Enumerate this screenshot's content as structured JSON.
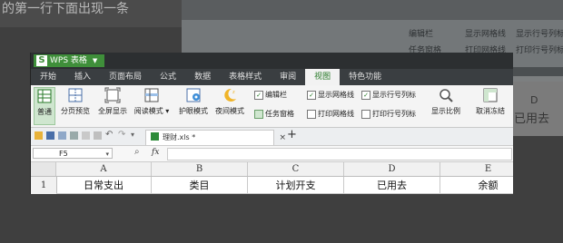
{
  "background": {
    "top_text": "的第一行下面出现一条",
    "right_text_1": "D",
    "right_text_2": "已用去",
    "bg_toolbar": [
      "编辑栏",
      "显示网格线",
      "显示行号列标",
      "任务窗格",
      "打印网格线",
      "打印行号列标"
    ]
  },
  "app": {
    "title": "WPS 表格"
  },
  "menu": [
    {
      "label": "开始",
      "active": false
    },
    {
      "label": "插入",
      "active": false
    },
    {
      "label": "页面布局",
      "active": false
    },
    {
      "label": "公式",
      "active": false
    },
    {
      "label": "数据",
      "active": false
    },
    {
      "label": "表格样式",
      "active": false
    },
    {
      "label": "审阅",
      "active": false
    },
    {
      "label": "视图",
      "active": true
    },
    {
      "label": "特色功能",
      "active": false
    }
  ],
  "ribbon": {
    "normal": "普通",
    "page_break_preview": "分页预览",
    "full_screen": "全屏显示",
    "reading_mode": "阅读模式",
    "eye_mode": "护眼模式",
    "night_mode": "夜间模式",
    "edit_bar": "编辑栏",
    "task_pane": "任务窗格",
    "show_gridlines": "显示网格线",
    "print_gridlines": "打印网格线",
    "show_row_col_headers": "显示行号列标",
    "print_row_col_headers": "打印行号列标",
    "zoom": "显示比例",
    "unfreeze": "取消冻结"
  },
  "file_tab": {
    "name": "理财.xls *"
  },
  "formula_bar": {
    "cell_ref": "F5",
    "fx": "fx"
  },
  "columns": [
    "A",
    "B",
    "C",
    "D",
    "E"
  ],
  "row": {
    "number": "1",
    "cells": [
      "日常支出",
      "类目",
      "计划开支",
      "已用去",
      "余额"
    ]
  },
  "colors": {
    "accent": "#3f8f3a",
    "title_bar": "#2c2f31",
    "menu_bar": "#3a3e41"
  }
}
